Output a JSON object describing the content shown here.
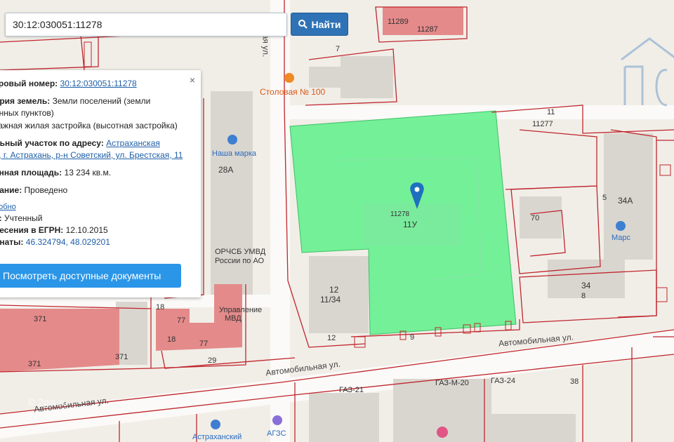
{
  "search": {
    "value": "30:12:030051:11278",
    "button_label": "Найти"
  },
  "panel": {
    "cadastral_label": "тровый номер:",
    "cadastral_value": "30:12:030051:11278",
    "category_label": "ория земель:",
    "category_value_line1": "Земли поселений (земли",
    "category_value_line2": "енных пунктов)",
    "usage_line": "тажная жилая застройка (высотная застройка)",
    "address_label": "льный участок по адресу:",
    "address_value_line1": "Астраханская",
    "address_value_line2": "ь, г. Астрахань, р-н Советский, ул. Брестская, 11",
    "area_label": "енная площадь:",
    "area_value": "13 234 кв.м.",
    "status_label": "вание:",
    "status_value": "Проведено",
    "details_link": "робно",
    "state_label": "с:",
    "state_value": "Учтенный",
    "date_label": "несения в ЕГРН:",
    "date_value": "12.10.2015",
    "coords_label": "инаты:",
    "coords_value": "46.324794, 48.029201",
    "docs_button": "Посмотреть доступные документы",
    "close_symbol": "×"
  },
  "map": {
    "streets": {
      "vertical": "ая ул.",
      "horizontal_right": "Автомобильная ул.",
      "horizontal_mid": "Автомобильная ул.",
      "horizontal_left": "Автомобильная ул."
    },
    "pois": {
      "canteen": "Столовая № 100",
      "car_wash": "Наша марка",
      "police_line1": "ОРЧСБ УМВД",
      "police_line2": "России по АО",
      "police2_line1": "Управление",
      "police2_line2": "МВД",
      "mars": "Марс",
      "agzs": "АГЗС",
      "astrakhan": "Астраханский",
      "gaz21": "ГАЗ-21",
      "gazm20": "ГАЗ-М-20",
      "gaz24": "ГАЗ-24"
    },
    "parcel": {
      "number": "11278",
      "house": "11У",
      "color": "#5ef08a"
    },
    "plot_numbers": [
      "11289",
      "11287",
      "7",
      "11",
      "11277",
      "28А",
      "34А",
      "70",
      "5",
      "34",
      "8",
      "12",
      "11/34",
      "9",
      "12",
      "18",
      "77",
      "18",
      "77",
      "371",
      "371",
      "371",
      "29",
      "38"
    ],
    "watermark": "© 2gis.ru"
  },
  "colors": {
    "boundary": "#c0262d",
    "building": "#d9d6d0",
    "pink_building": "#e48a8a",
    "primary_button": "#2f73b6",
    "docs_button": "#2b96e8"
  }
}
